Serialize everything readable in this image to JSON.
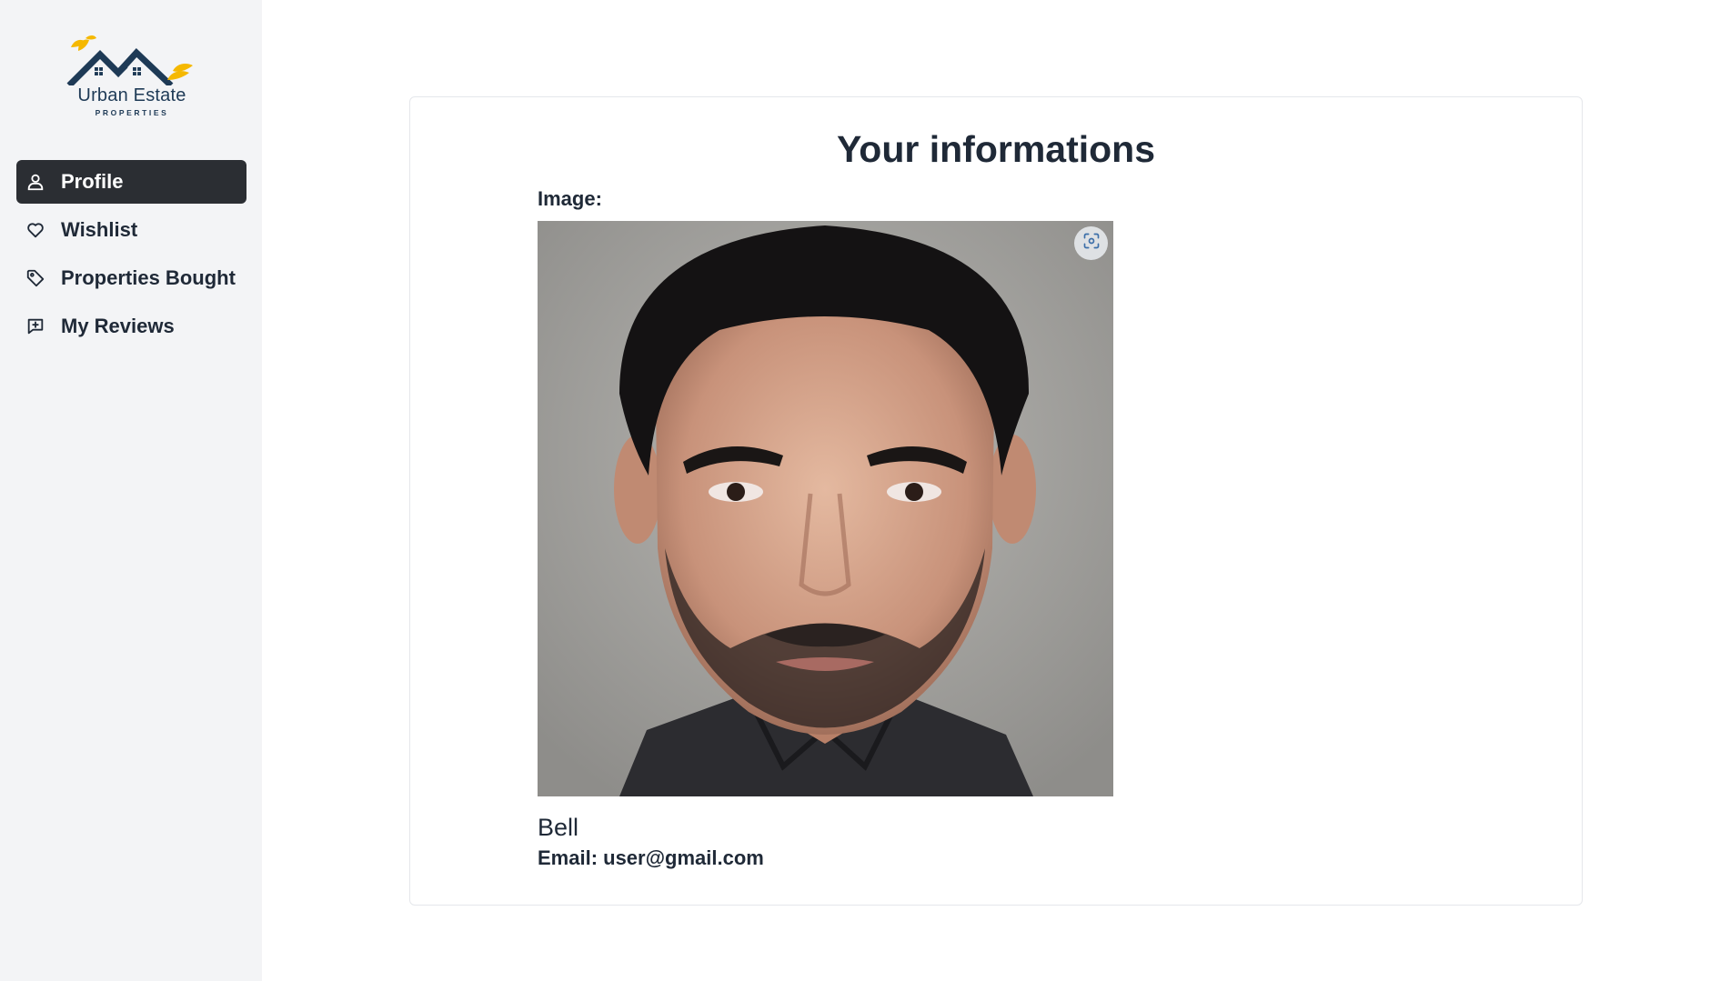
{
  "brand": {
    "name": "Urban Estate",
    "tagline": "PROPERTIES",
    "colors": {
      "navy": "#1e3a56",
      "gold": "#f5b800"
    }
  },
  "sidebar": {
    "items": [
      {
        "label": "Profile",
        "icon": "user-icon",
        "active": true
      },
      {
        "label": "Wishlist",
        "icon": "heart-icon",
        "active": false
      },
      {
        "label": "Properties Bought",
        "icon": "tag-icon",
        "active": false
      },
      {
        "label": "My Reviews",
        "icon": "message-plus-icon",
        "active": false
      }
    ]
  },
  "main": {
    "title": "Your informations",
    "image_label": "Image:",
    "user": {
      "name": "Bell",
      "email_text": "Email: user@gmail.com"
    },
    "photo_icon": "visual-search-icon"
  },
  "colors": {
    "sidebar_bg": "#f3f4f6",
    "active_item_bg": "#2b2e33",
    "text": "#1f2937"
  }
}
